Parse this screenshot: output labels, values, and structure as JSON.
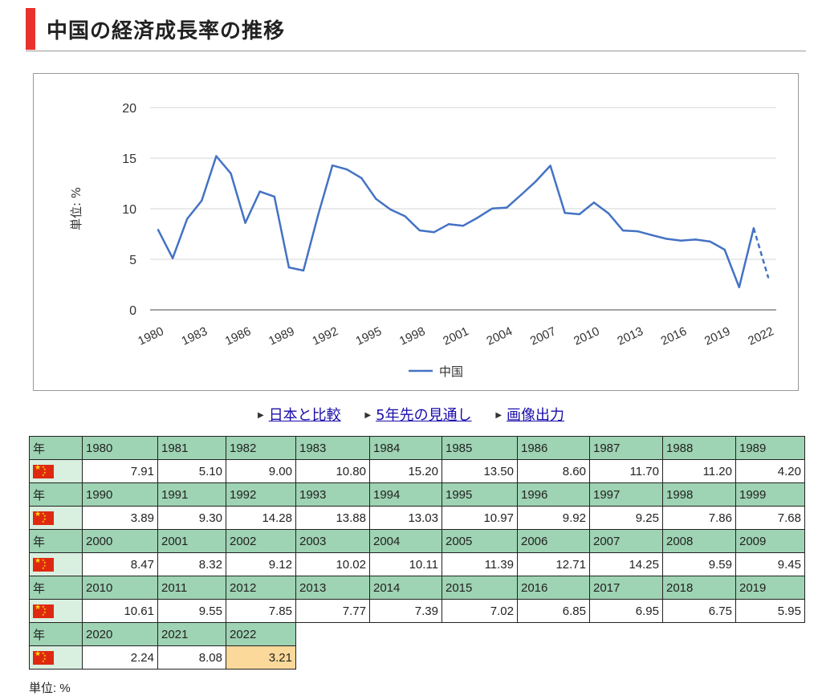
{
  "header": {
    "title": "中国の経済成長率の推移"
  },
  "chart_data": {
    "type": "line",
    "ylabel": "単位: %",
    "ylim": [
      0,
      20
    ],
    "yticks": [
      0,
      5,
      10,
      15,
      20
    ],
    "xticks": [
      "1980",
      "1983",
      "1986",
      "1989",
      "1992",
      "1995",
      "1998",
      "2001",
      "2004",
      "2007",
      "2010",
      "2013",
      "2016",
      "2019",
      "2022"
    ],
    "grid": true,
    "legend_position": "bottom",
    "series": [
      {
        "name": "中国",
        "color": "#4472c4",
        "forecast_from": 2021,
        "x": [
          1980,
          1981,
          1982,
          1983,
          1984,
          1985,
          1986,
          1987,
          1988,
          1989,
          1990,
          1991,
          1992,
          1993,
          1994,
          1995,
          1996,
          1997,
          1998,
          1999,
          2000,
          2001,
          2002,
          2003,
          2004,
          2005,
          2006,
          2007,
          2008,
          2009,
          2010,
          2011,
          2012,
          2013,
          2014,
          2015,
          2016,
          2017,
          2018,
          2019,
          2020,
          2021,
          2022
        ],
        "values": [
          7.91,
          5.1,
          9.0,
          10.8,
          15.2,
          13.5,
          8.6,
          11.7,
          11.2,
          4.2,
          3.89,
          9.3,
          14.28,
          13.88,
          13.03,
          10.97,
          9.92,
          9.25,
          7.86,
          7.68,
          8.47,
          8.32,
          9.12,
          10.02,
          10.11,
          11.39,
          12.71,
          14.25,
          9.59,
          9.45,
          10.61,
          9.55,
          7.85,
          7.77,
          7.39,
          7.02,
          6.85,
          6.95,
          6.75,
          5.95,
          2.24,
          8.08,
          3.21
        ]
      }
    ]
  },
  "links": [
    {
      "label": "日本と比較"
    },
    {
      "label": "5年先の見通し"
    },
    {
      "label": "画像出力"
    }
  ],
  "table": {
    "year_label": "年",
    "country_icon": "china-flag-icon",
    "flag_color": "#de2910",
    "forecast_color": "#fbd99a",
    "rows": [
      {
        "years": [
          "1980",
          "1981",
          "1982",
          "1983",
          "1984",
          "1985",
          "1986",
          "1987",
          "1988",
          "1989"
        ],
        "values": [
          "7.91",
          "5.10",
          "9.00",
          "10.80",
          "15.20",
          "13.50",
          "8.60",
          "11.70",
          "11.20",
          "4.20"
        ]
      },
      {
        "years": [
          "1990",
          "1991",
          "1992",
          "1993",
          "1994",
          "1995",
          "1996",
          "1997",
          "1998",
          "1999"
        ],
        "values": [
          "3.89",
          "9.30",
          "14.28",
          "13.88",
          "13.03",
          "10.97",
          "9.92",
          "9.25",
          "7.86",
          "7.68"
        ]
      },
      {
        "years": [
          "2000",
          "2001",
          "2002",
          "2003",
          "2004",
          "2005",
          "2006",
          "2007",
          "2008",
          "2009"
        ],
        "values": [
          "8.47",
          "8.32",
          "9.12",
          "10.02",
          "10.11",
          "11.39",
          "12.71",
          "14.25",
          "9.59",
          "9.45"
        ]
      },
      {
        "years": [
          "2010",
          "2011",
          "2012",
          "2013",
          "2014",
          "2015",
          "2016",
          "2017",
          "2018",
          "2019"
        ],
        "values": [
          "10.61",
          "9.55",
          "7.85",
          "7.77",
          "7.39",
          "7.02",
          "6.85",
          "6.95",
          "6.75",
          "5.95"
        ]
      },
      {
        "years": [
          "2020",
          "2021",
          "2022"
        ],
        "values": [
          "2.24",
          "8.08",
          "3.21"
        ]
      }
    ]
  },
  "footer": {
    "unit_note": "単位: %"
  }
}
